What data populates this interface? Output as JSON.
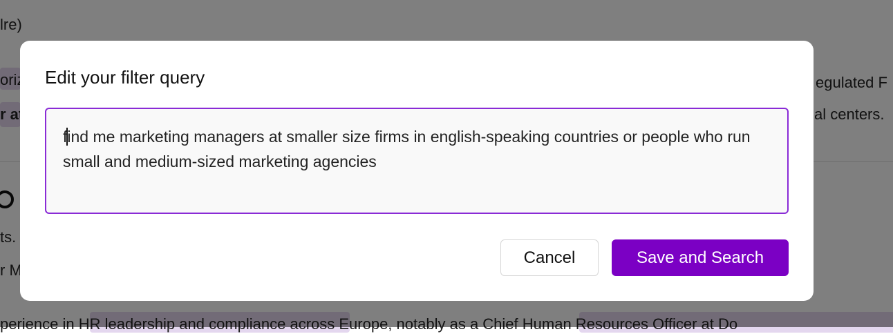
{
  "background": {
    "line1": "lre)",
    "line2_left": "oriz",
    "line2_right": "egulated F",
    "line3_left": "r at",
    "line3_right": "al centers.",
    "line4_left": "ts.",
    "line5_left": "r M",
    "bottom_line": "perience in  HR leadership and compliance  across Europe, notably as a  Chief Human Resources Officer at Do"
  },
  "modal": {
    "title": "Edit your filter query",
    "query_before_caret": "f",
    "query_after_caret": "ind me marketing managers at smaller size firms in english-speaking countries or people who run small and medium-sized marketing agencies",
    "cancel_label": "Cancel",
    "save_label": "Save and Search"
  },
  "colors": {
    "accent": "#7b00c4",
    "focus_border": "#8a2bd6",
    "overlay": "rgba(0,0,0,0.5)"
  }
}
